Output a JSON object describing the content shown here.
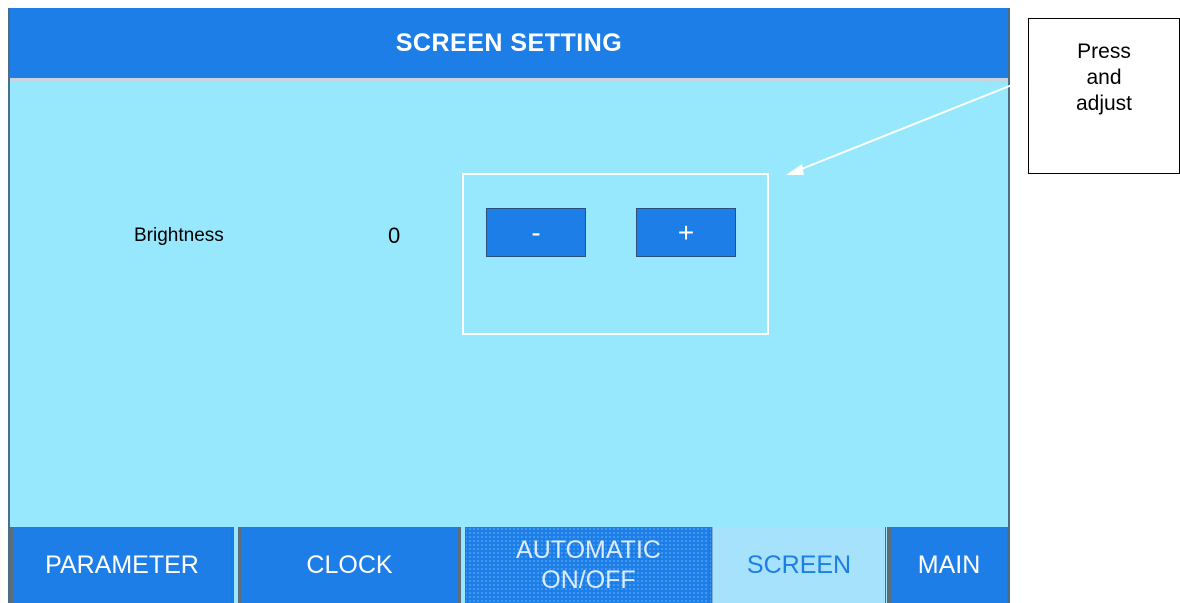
{
  "header": {
    "title": "SCREEN SETTING"
  },
  "brightness": {
    "label": "Brightness",
    "value": "0",
    "decrease_label": "-",
    "increase_label": "+"
  },
  "nav": {
    "parameter": "PARAMETER",
    "clock": "CLOCK",
    "automatic_line1": "AUTOMATIC",
    "automatic_line2": "ON/OFF",
    "screen": "SCREEN",
    "main": "MAIN"
  },
  "callout": {
    "line1": "Press",
    "line2": "and",
    "line3": "adjust"
  },
  "colors": {
    "panel_bg": "#97e8fc",
    "accent_blue": "#1c7ee6",
    "active_tab_bg": "#a6e2fb"
  }
}
